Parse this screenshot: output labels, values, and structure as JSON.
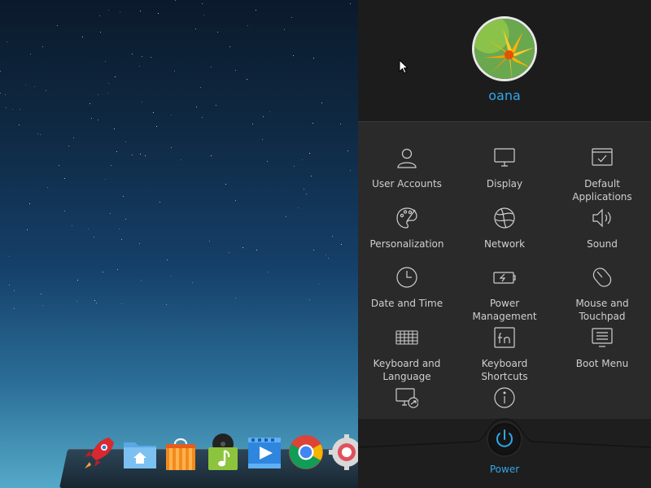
{
  "user": {
    "name": "oana"
  },
  "modules": [
    {
      "name": "user-accounts",
      "label": "User Accounts",
      "icon": "user-icon"
    },
    {
      "name": "display",
      "label": "Display",
      "icon": "monitor-icon"
    },
    {
      "name": "default-applications",
      "label": "Default\nApplications",
      "icon": "default-apps-icon"
    },
    {
      "name": "personalization",
      "label": "Personalization",
      "icon": "palette-icon"
    },
    {
      "name": "network",
      "label": "Network",
      "icon": "globe-icon"
    },
    {
      "name": "sound",
      "label": "Sound",
      "icon": "speaker-icon"
    },
    {
      "name": "date-and-time",
      "label": "Date and Time",
      "icon": "clock-icon"
    },
    {
      "name": "power-management",
      "label": "Power\nManagement",
      "icon": "battery-icon"
    },
    {
      "name": "mouse-and-touchpad",
      "label": "Mouse and\nTouchpad",
      "icon": "mouse-icon"
    },
    {
      "name": "keyboard-and-language",
      "label": "Keyboard and\nLanguage",
      "icon": "keyboard-icon"
    },
    {
      "name": "keyboard-shortcuts",
      "label": "Keyboard\nShortcuts",
      "icon": "fn-key-icon"
    },
    {
      "name": "boot-menu",
      "label": "Boot Menu",
      "icon": "boot-menu-icon"
    },
    {
      "name": "system-update",
      "label": "",
      "icon": "monitor-update-icon"
    },
    {
      "name": "system-info",
      "label": "",
      "icon": "info-icon"
    }
  ],
  "power": {
    "label": "Power",
    "icon": "power-icon"
  },
  "dock": {
    "items": [
      {
        "name": "launcher",
        "icon": "rocket-icon"
      },
      {
        "name": "file-manager",
        "icon": "folder-home-icon"
      },
      {
        "name": "app-store",
        "icon": "shopping-bag-icon"
      },
      {
        "name": "music-player",
        "icon": "music-note-icon"
      },
      {
        "name": "video-player",
        "icon": "video-play-icon"
      },
      {
        "name": "chrome",
        "icon": "chrome-icon"
      },
      {
        "name": "settings",
        "icon": "gear-icon"
      }
    ]
  },
  "colors": {
    "accent": "#2fa7ea",
    "panel_bg": "#2a2a2a",
    "header_bg": "#1c1c1c",
    "label_text": "#cfcfcf"
  }
}
